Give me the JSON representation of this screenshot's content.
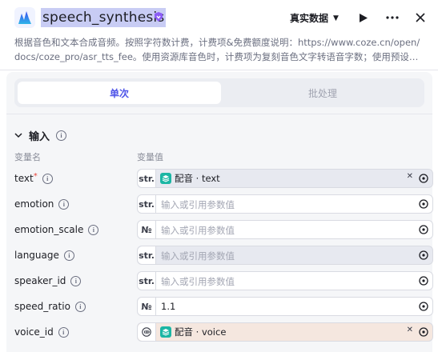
{
  "header": {
    "title": "speech_synthesis",
    "env_label": "真实数据",
    "icons": [
      "logo-icon",
      "verified-icon",
      "caret-down-icon",
      "play-icon",
      "more-icon",
      "close-icon"
    ]
  },
  "description": {
    "line1": "根据音色和文本合成音频。按照字符数计费，计费项&免费额度说明：https://www.coze.cn/open/",
    "line2": "docs/coze_pro/asr_tts_fee。使用资源库音色时，计费项为复刻音色文字转语音字数；使用预设…"
  },
  "tabs": [
    {
      "label": "单次",
      "active": true
    },
    {
      "label": "批处理",
      "active": false
    }
  ],
  "section": {
    "title": "输入",
    "col_name": "变量名",
    "col_value": "变量值"
  },
  "inputs": [
    {
      "label": "text",
      "required": "*",
      "type": "str.",
      "ref_label": "配音 · text",
      "placeholder": ""
    },
    {
      "label": "emotion",
      "type": "str.",
      "placeholder": "输入或引用参数值"
    },
    {
      "label": "emotion_scale",
      "type": "№",
      "placeholder": "输入或引用参数值"
    },
    {
      "label": "language",
      "type": "str.",
      "placeholder": "输入或引用参数值"
    },
    {
      "label": "speaker_id",
      "type": "str.",
      "placeholder": "输入或引用参数值"
    },
    {
      "label": "speed_ratio",
      "type": "№",
      "value": "1.1"
    },
    {
      "label": "voice_id",
      "type": "voice",
      "ref_label": "配音 · voice"
    }
  ],
  "colors": {
    "accent": "#4d53e8",
    "title_highlight": "#c8ccf4",
    "ref_icon": "#1bb6a4",
    "voice_field_bg": "#f5e7df",
    "disabled_field_bg": "#e7e9f0"
  }
}
